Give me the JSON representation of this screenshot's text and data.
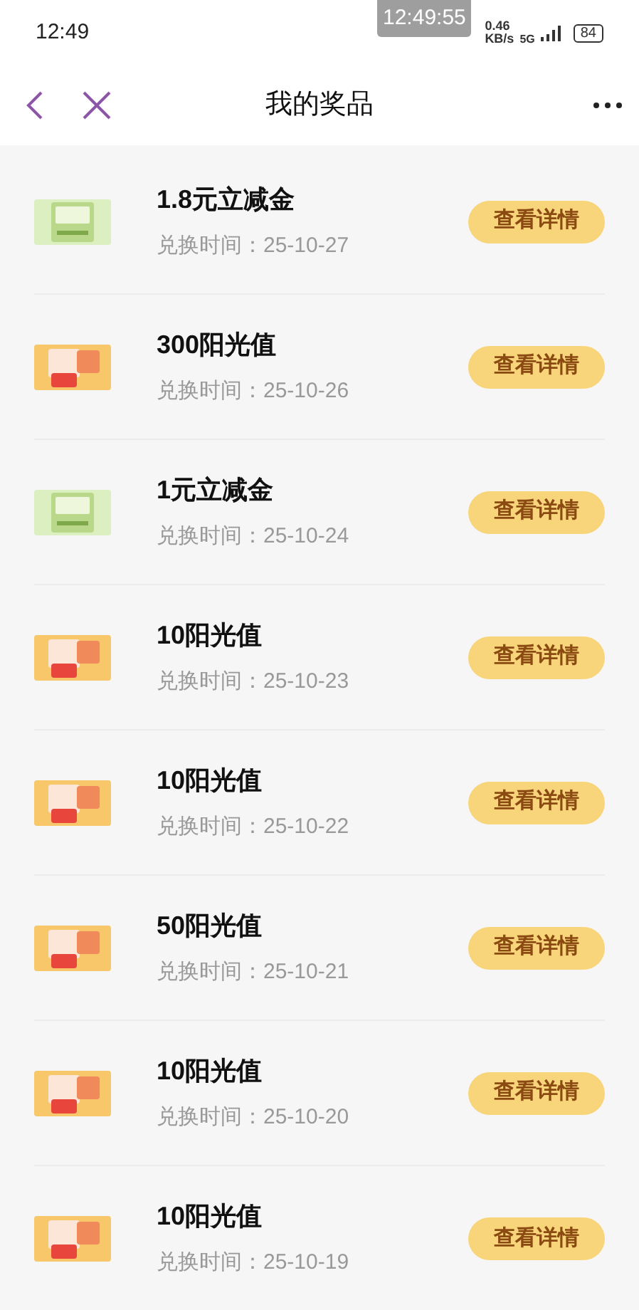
{
  "status_bar": {
    "time": "12:49",
    "speed": "0.46",
    "speed_unit": "KB/s",
    "network": "5G",
    "battery": "84"
  },
  "floating_clock": "12:49:55",
  "nav": {
    "title": "我的奖品"
  },
  "prizes": [
    {
      "kind": "voucher",
      "name": "1.8元立减金",
      "date": "兑换时间：25-10-27",
      "button": "查看详情"
    },
    {
      "kind": "sunshine",
      "name": "300阳光值",
      "date": "兑换时间：25-10-26",
      "button": "查看详情"
    },
    {
      "kind": "voucher",
      "name": "1元立减金",
      "date": "兑换时间：25-10-24",
      "button": "查看详情"
    },
    {
      "kind": "sunshine",
      "name": "10阳光值",
      "date": "兑换时间：25-10-23",
      "button": "查看详情"
    },
    {
      "kind": "sunshine",
      "name": "10阳光值",
      "date": "兑换时间：25-10-22",
      "button": "查看详情"
    },
    {
      "kind": "sunshine",
      "name": "50阳光值",
      "date": "兑换时间：25-10-21",
      "button": "查看详情"
    },
    {
      "kind": "sunshine",
      "name": "10阳光值",
      "date": "兑换时间：25-10-20",
      "button": "查看详情"
    },
    {
      "kind": "sunshine",
      "name": "10阳光值",
      "date": "兑换时间：25-10-19",
      "button": "查看详情"
    }
  ]
}
